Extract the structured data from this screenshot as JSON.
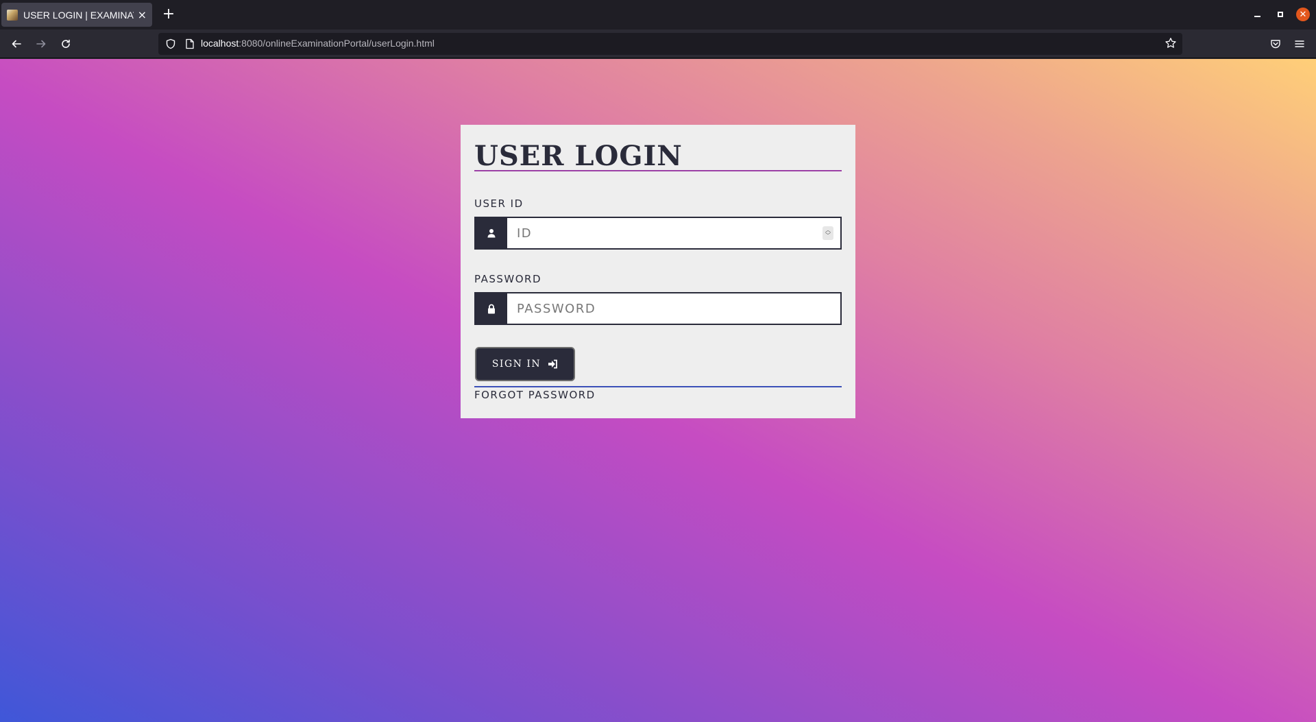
{
  "browser": {
    "tab_title": "USER LOGIN | EXAMINATION",
    "new_tab_symbol": "+",
    "close_symbol": "×",
    "url_host": "localhost",
    "url_rest": ":8080/onlineExaminationPortal/userLogin.html"
  },
  "login": {
    "title": "USER LOGIN",
    "userid_label": "USER ID",
    "userid_placeholder": "ID",
    "password_label": "PASSWORD",
    "password_placeholder": "PASSWORD",
    "signin_label": "SIGN IN",
    "forgot_label": "FORGOT PASSWORD"
  },
  "colors": {
    "card_bg": "#eeeeee",
    "dark": "#2a2b3a",
    "title_rule": "#9b3fa5",
    "forgot_rule": "#3b4fb8"
  }
}
